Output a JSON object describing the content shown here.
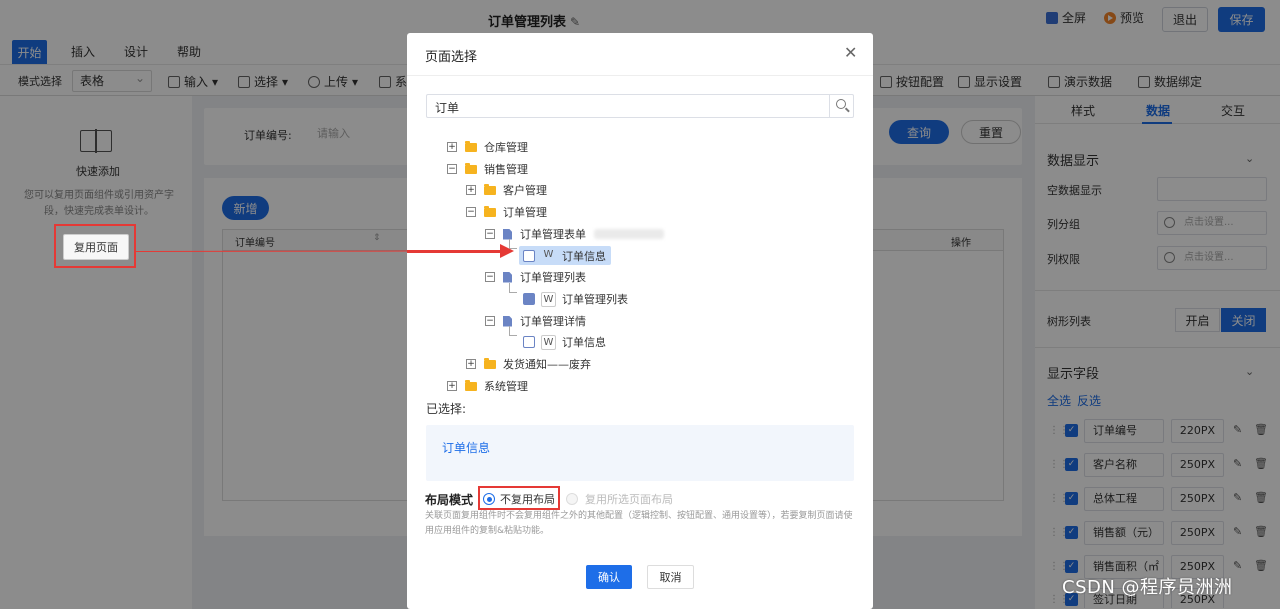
{
  "topbar": {
    "title": "订单管理列表",
    "edit_icon": "✎",
    "fullscreen": "全屏",
    "preview": "预览",
    "exit": "退出",
    "save": "保存"
  },
  "menu": [
    "开始",
    "插入",
    "设计",
    "帮助"
  ],
  "toolbar": {
    "mode_label": "模式选择",
    "mode_value": "表格",
    "items": [
      "输入",
      "选择",
      "上传",
      "系"
    ],
    "right_items": [
      "按钮配置",
      "显示设置",
      "演示数据",
      "数据绑定"
    ]
  },
  "left_panel": {
    "title": "快速添加",
    "desc": "您可以复用页面组件或引用资产字段，快速完成表单设计。",
    "reuse_button": "复用页面"
  },
  "search_card": {
    "label": "订单编号:",
    "placeholder": "请输入",
    "query": "查询",
    "reset": "重置"
  },
  "table_card": {
    "add": "新增",
    "col1": "订单编号",
    "sort": "⇕",
    "op": "操作"
  },
  "right_panel": {
    "tabs": [
      "样式",
      "数据",
      "交互"
    ],
    "data_display": "数据显示",
    "empty_display": "空数据显示",
    "col_group": "列分组",
    "col_perm": "列权限",
    "click_setting": "点击设置...",
    "tree_list": "树形列表",
    "on": "开启",
    "off": "关闭",
    "display_fields": "显示字段",
    "select_all": "全选",
    "invert": "反选",
    "fields": [
      {
        "name": "订单编号",
        "width": "220PX"
      },
      {
        "name": "客户名称",
        "width": "250PX"
      },
      {
        "name": "总体工程",
        "width": "250PX"
      },
      {
        "name": "销售额（元）",
        "width": "250PX"
      },
      {
        "name": "销售面积（㎡",
        "width": "250PX"
      },
      {
        "name": "签订日期",
        "width": "250PX"
      }
    ]
  },
  "modal": {
    "title": "页面选择",
    "search_value": "订单",
    "tree": {
      "warehouse": "仓库管理",
      "sales": "销售管理",
      "customer": "客户管理",
      "order": "订单管理",
      "order_form": "订单管理表单",
      "order_info": "订单信息",
      "order_list": "订单管理列表",
      "order_list_page": "订单管理列表",
      "order_detail": "订单管理详情",
      "order_detail_page": "订单信息",
      "shipping": "发货通知——废弃",
      "system": "系统管理",
      "w_badge": "W"
    },
    "selected_label": "已选择:",
    "selected_value": "订单信息",
    "layout_label": "布局模式",
    "option1": "不复用布局",
    "option2": "复用所选页面布局",
    "note": "关联页面复用组件时不会复用组件之外的其他配置（逻辑控制、按钮配置、通用设置等），若要复制页面请使用应用组件的复制&粘贴功能。",
    "ok": "确认",
    "cancel": "取消"
  },
  "watermark": "CSDN @程序员洲洲"
}
